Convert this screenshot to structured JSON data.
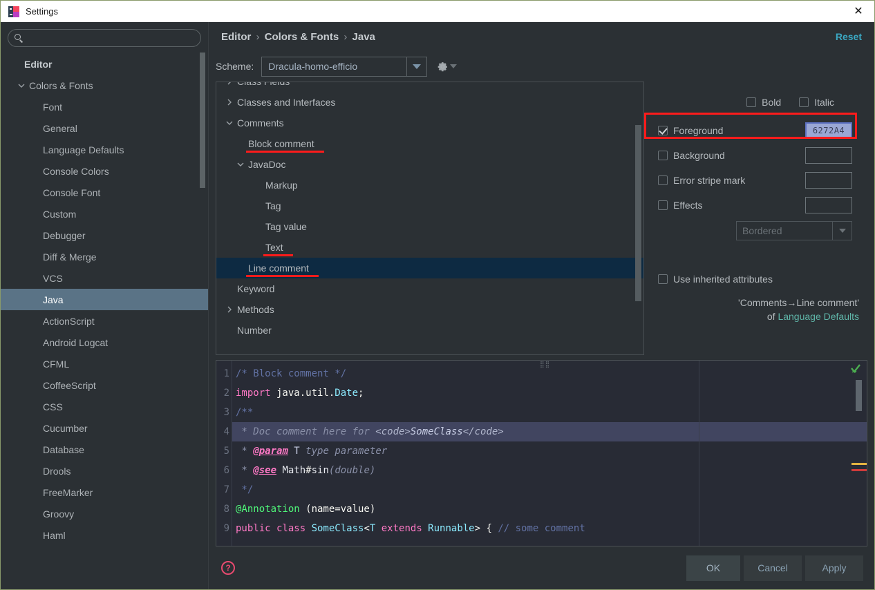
{
  "window": {
    "title": "Settings",
    "close_label": "✕",
    "app_icon": "intellij-idea-icon"
  },
  "search": {
    "value": "",
    "placeholder": ""
  },
  "sidebar": {
    "items": [
      {
        "label": "Editor",
        "level": "root",
        "twisty": "none"
      },
      {
        "label": "Colors & Fonts",
        "level": "lvl1",
        "twisty": "expanded"
      },
      {
        "label": "Font",
        "level": "lvl2",
        "twisty": "none"
      },
      {
        "label": "General",
        "level": "lvl2",
        "twisty": "none"
      },
      {
        "label": "Language Defaults",
        "level": "lvl2",
        "twisty": "none"
      },
      {
        "label": "Console Colors",
        "level": "lvl2",
        "twisty": "none"
      },
      {
        "label": "Console Font",
        "level": "lvl2",
        "twisty": "none"
      },
      {
        "label": "Custom",
        "level": "lvl2",
        "twisty": "none"
      },
      {
        "label": "Debugger",
        "level": "lvl2",
        "twisty": "none"
      },
      {
        "label": "Diff & Merge",
        "level": "lvl2",
        "twisty": "none"
      },
      {
        "label": "VCS",
        "level": "lvl2",
        "twisty": "none"
      },
      {
        "label": "Java",
        "level": "lvl2",
        "twisty": "none",
        "selected": true
      },
      {
        "label": "ActionScript",
        "level": "lvl2",
        "twisty": "none"
      },
      {
        "label": "Android Logcat",
        "level": "lvl2",
        "twisty": "none"
      },
      {
        "label": "CFML",
        "level": "lvl2",
        "twisty": "none"
      },
      {
        "label": "CoffeeScript",
        "level": "lvl2",
        "twisty": "none"
      },
      {
        "label": "CSS",
        "level": "lvl2",
        "twisty": "none"
      },
      {
        "label": "Cucumber",
        "level": "lvl2",
        "twisty": "none"
      },
      {
        "label": "Database",
        "level": "lvl2",
        "twisty": "none"
      },
      {
        "label": "Drools",
        "level": "lvl2",
        "twisty": "none"
      },
      {
        "label": "FreeMarker",
        "level": "lvl2",
        "twisty": "none"
      },
      {
        "label": "Groovy",
        "level": "lvl2",
        "twisty": "none"
      },
      {
        "label": "Haml",
        "level": "lvl2",
        "twisty": "none"
      }
    ]
  },
  "header": {
    "breadcrumb": [
      "Editor",
      "Colors & Fonts",
      "Java"
    ],
    "breadcrumb_separator": "›",
    "reset_label": "Reset"
  },
  "scheme": {
    "label": "Scheme:",
    "value": "Dracula-homo-efficio",
    "gear_icon": "gear-icon"
  },
  "color_tree": {
    "items": [
      {
        "label": "Class Fields",
        "indent": "ind1",
        "twisty": "collapsed",
        "clipped": true
      },
      {
        "label": "Classes and Interfaces",
        "indent": "ind1",
        "twisty": "collapsed"
      },
      {
        "label": "Comments",
        "indent": "ind1",
        "twisty": "expanded"
      },
      {
        "label": "Block comment",
        "indent": "ind2",
        "twisty": "none",
        "annotated": true
      },
      {
        "label": "JavaDoc",
        "indent": "ind2",
        "twisty": "expanded"
      },
      {
        "label": "Markup",
        "indent": "ind3",
        "twisty": "none"
      },
      {
        "label": "Tag",
        "indent": "ind3",
        "twisty": "none"
      },
      {
        "label": "Tag value",
        "indent": "ind3",
        "twisty": "none"
      },
      {
        "label": "Text",
        "indent": "ind3",
        "twisty": "none",
        "annotated": true
      },
      {
        "label": "Line comment",
        "indent": "ind2",
        "twisty": "none",
        "annotated": true,
        "selected": true
      },
      {
        "label": "Keyword",
        "indent": "ind1",
        "twisty": "none"
      },
      {
        "label": "Methods",
        "indent": "ind1",
        "twisty": "collapsed"
      },
      {
        "label": "Number",
        "indent": "ind1",
        "twisty": "none"
      }
    ]
  },
  "attributes": {
    "bold": {
      "label": "Bold",
      "checked": false
    },
    "italic": {
      "label": "Italic",
      "checked": false
    },
    "rows": [
      {
        "label": "Foreground",
        "checked": true,
        "swatch_value": "6272A4",
        "active": true
      },
      {
        "label": "Background",
        "checked": false,
        "swatch_value": "",
        "active": false
      },
      {
        "label": "Error stripe mark",
        "checked": false,
        "swatch_value": "",
        "active": false
      },
      {
        "label": "Effects",
        "checked": false,
        "swatch_value": "",
        "active": false
      }
    ],
    "effect_type": "Bordered",
    "use_inherited": {
      "label": "Use inherited attributes",
      "checked": false
    },
    "inherit_note_line1": "'Comments→Line comment'",
    "inherit_note_prefix": "of ",
    "inherit_note_link": "Language Defaults",
    "highlight_color": "#ff1b1b"
  },
  "preview": {
    "line_numbers": [
      "1",
      "2",
      "3",
      "4",
      "5",
      "6",
      "7",
      "8",
      "9"
    ],
    "lines": [
      {
        "n": 1,
        "highlighted": false,
        "tokens": [
          {
            "t": "/* Block comment */",
            "c": "#6272a4"
          }
        ]
      },
      {
        "n": 2,
        "highlighted": false,
        "tokens": [
          {
            "t": "import",
            "c": "#ff79c6"
          },
          {
            "t": " java.util.",
            "c": "#f8f8f2"
          },
          {
            "t": "Date",
            "c": "#8be9fd"
          },
          {
            "t": ";",
            "c": "#f8f8f2"
          }
        ]
      },
      {
        "n": 3,
        "highlighted": false,
        "tokens": [
          {
            "t": "/**",
            "c": "#6272a4"
          }
        ]
      },
      {
        "n": 4,
        "highlighted": true,
        "tokens": [
          {
            "t": " * Doc comment here for ",
            "c": "#8a90a8",
            "i": true
          },
          {
            "t": "<code>",
            "c": "#b0b6cc",
            "i": true
          },
          {
            "t": "SomeClass",
            "c": "#c9cfe6",
            "i": true
          },
          {
            "t": "</code>",
            "c": "#b0b6cc",
            "i": true
          }
        ]
      },
      {
        "n": 5,
        "highlighted": false,
        "tokens": [
          {
            "t": " * ",
            "c": "#8a90a8",
            "i": true
          },
          {
            "t": "@param",
            "c": "#ff79c6",
            "i": true,
            "b": true,
            "u": true
          },
          {
            "t": " T ",
            "c": "#c9cfe6",
            "i": false
          },
          {
            "t": "type parameter",
            "c": "#8a90a8",
            "i": true
          }
        ]
      },
      {
        "n": 6,
        "highlighted": false,
        "tokens": [
          {
            "t": " * ",
            "c": "#8a90a8",
            "i": true
          },
          {
            "t": "@see",
            "c": "#ff79c6",
            "i": true,
            "b": true,
            "u": true
          },
          {
            "t": " Math",
            "c": "#e8eaf0"
          },
          {
            "t": "#",
            "c": "#f8f8f2"
          },
          {
            "t": "sin",
            "c": "#e8eaf0"
          },
          {
            "t": "(double)",
            "c": "#8a90a8",
            "i": true
          }
        ]
      },
      {
        "n": 7,
        "highlighted": false,
        "tokens": [
          {
            "t": " */",
            "c": "#6272a4"
          }
        ]
      },
      {
        "n": 8,
        "highlighted": false,
        "tokens": [
          {
            "t": "@Annotation",
            "c": "#50fa7b"
          },
          {
            "t": " (name=value)",
            "c": "#f8f8f2"
          }
        ]
      },
      {
        "n": 9,
        "highlighted": false,
        "tokens": [
          {
            "t": "public class ",
            "c": "#ff79c6"
          },
          {
            "t": "SomeClass",
            "c": "#8be9fd"
          },
          {
            "t": "<",
            "c": "#f8f8f2"
          },
          {
            "t": "T",
            "c": "#8be9fd"
          },
          {
            "t": " extends ",
            "c": "#ff79c6"
          },
          {
            "t": "Runnable",
            "c": "#8be9fd"
          },
          {
            "t": "> { ",
            "c": "#f8f8f2"
          },
          {
            "t": "// some comment",
            "c": "#6272a4"
          }
        ]
      }
    ],
    "status_icon": "inspection-ok-checkmark-icon",
    "stripe_warning_color": "#e3b341",
    "stripe_error_color": "#d03b3b"
  },
  "footer": {
    "help_icon": "help-question-icon",
    "ok_label": "OK",
    "cancel_label": "Cancel",
    "apply_label": "Apply"
  }
}
